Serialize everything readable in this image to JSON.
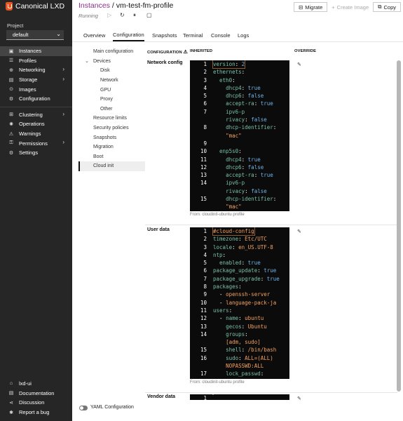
{
  "app": {
    "name": "Canonical LXD"
  },
  "project": {
    "label": "Project",
    "value": "default"
  },
  "sidebar": {
    "items": [
      {
        "label": "Instances",
        "icon": "instances-icon",
        "glyph": "▣",
        "active": true
      },
      {
        "label": "Profiles",
        "icon": "profiles-icon",
        "glyph": "☰"
      },
      {
        "label": "Networking",
        "icon": "networking-icon",
        "glyph": "⊕",
        "arrow": true
      },
      {
        "label": "Storage",
        "icon": "storage-icon",
        "glyph": "▤",
        "arrow": true
      },
      {
        "label": "Images",
        "icon": "images-icon",
        "glyph": "⊙"
      },
      {
        "label": "Configuration",
        "icon": "configuration-icon",
        "glyph": "⚙"
      }
    ],
    "items2": [
      {
        "label": "Clustering",
        "icon": "clustering-icon",
        "glyph": "⊞",
        "arrow": true
      },
      {
        "label": "Operations",
        "icon": "operations-icon",
        "glyph": "✺"
      },
      {
        "label": "Warnings",
        "icon": "warnings-icon",
        "glyph": "⚠"
      },
      {
        "label": "Permissions",
        "icon": "permissions-icon",
        "glyph": "⚿",
        "arrow": true
      },
      {
        "label": "Settings",
        "icon": "settings-icon",
        "glyph": "⚙"
      }
    ],
    "footer": [
      {
        "label": "lxd-ui",
        "icon": "code-icon",
        "glyph": "⌂"
      },
      {
        "label": "Documentation",
        "icon": "documentation-icon",
        "glyph": "▤"
      },
      {
        "label": "Discussion",
        "icon": "discussion-icon",
        "glyph": "⋖"
      },
      {
        "label": "Report a bug",
        "icon": "bug-icon",
        "glyph": "✱"
      }
    ]
  },
  "header": {
    "breadcrumb_link": "Instances",
    "breadcrumb_sep": " / ",
    "instance_name": "vm-test-fm-profile",
    "status": "Running",
    "migrate_label": "Migrate",
    "create_image_label": "Create Image",
    "copy_label": "Copy"
  },
  "tabs": [
    "Overview",
    "Configuration",
    "Snapshots",
    "Terminal",
    "Console",
    "Logs"
  ],
  "subnav": [
    {
      "label": "Main configuration"
    },
    {
      "label": "Devices",
      "arrow": true
    },
    {
      "label": "Disk",
      "indent": true
    },
    {
      "label": "Network",
      "indent": true
    },
    {
      "label": "GPU",
      "indent": true
    },
    {
      "label": "Proxy",
      "indent": true
    },
    {
      "label": "Other",
      "indent": true
    },
    {
      "label": "Resource limits"
    },
    {
      "label": "Security policies"
    },
    {
      "label": "Snapshots"
    },
    {
      "label": "Migration"
    },
    {
      "label": "Boot"
    },
    {
      "label": "Cloud init",
      "active": true
    }
  ],
  "table": {
    "col_configuration": "CONFIGURATION",
    "col_inherited": "INHERITED",
    "col_override": "OVERRIDE"
  },
  "rows": [
    {
      "label": "Network config",
      "from": "From: cloudinit-ubuntu profile",
      "lines": [
        {
          "n": "1",
          "t": [
            [
              "k",
              "version"
            ],
            [
              "w",
              ": "
            ],
            [
              "b",
              "2"
            ]
          ]
        },
        {
          "n": "2",
          "t": [
            [
              "k",
              "ethernets"
            ],
            [
              "w",
              ":"
            ]
          ]
        },
        {
          "n": "3",
          "t": [
            [
              "w",
              "  "
            ],
            [
              "k",
              "eth0"
            ],
            [
              "w",
              ":"
            ]
          ]
        },
        {
          "n": "4",
          "t": [
            [
              "w",
              "    "
            ],
            [
              "k",
              "dhcp4"
            ],
            [
              "w",
              ": "
            ],
            [
              "b",
              "true"
            ]
          ]
        },
        {
          "n": "5",
          "t": [
            [
              "w",
              "    "
            ],
            [
              "k",
              "dhcp6"
            ],
            [
              "w",
              ": "
            ],
            [
              "b",
              "false"
            ]
          ]
        },
        {
          "n": "6",
          "t": [
            [
              "w",
              "    "
            ],
            [
              "k",
              "accept-ra"
            ],
            [
              "w",
              ": "
            ],
            [
              "b",
              "true"
            ]
          ]
        },
        {
          "n": "7",
          "t": [
            [
              "w",
              "    "
            ],
            [
              "k",
              "ipv6-p"
            ]
          ]
        },
        {
          "n": "",
          "t": [
            [
              "w",
              "    "
            ],
            [
              "k",
              "rivacy"
            ],
            [
              "w",
              ": "
            ],
            [
              "b",
              "false"
            ]
          ]
        },
        {
          "n": "8",
          "t": [
            [
              "w",
              "    "
            ],
            [
              "k",
              "dhcp-identifier"
            ],
            [
              "w",
              ":"
            ]
          ]
        },
        {
          "n": "",
          "t": [
            [
              "w",
              "    "
            ],
            [
              "v",
              "\"mac\""
            ]
          ]
        },
        {
          "n": "9",
          "t": []
        },
        {
          "n": "10",
          "t": [
            [
              "w",
              "  "
            ],
            [
              "k",
              "enp5s0"
            ],
            [
              "w",
              ":"
            ]
          ]
        },
        {
          "n": "11",
          "t": [
            [
              "w",
              "    "
            ],
            [
              "k",
              "dhcp4"
            ],
            [
              "w",
              ": "
            ],
            [
              "b",
              "true"
            ]
          ]
        },
        {
          "n": "12",
          "t": [
            [
              "w",
              "    "
            ],
            [
              "k",
              "dhcp6"
            ],
            [
              "w",
              ": "
            ],
            [
              "b",
              "false"
            ]
          ]
        },
        {
          "n": "13",
          "t": [
            [
              "w",
              "    "
            ],
            [
              "k",
              "accept-ra"
            ],
            [
              "w",
              ": "
            ],
            [
              "b",
              "true"
            ]
          ]
        },
        {
          "n": "14",
          "t": [
            [
              "w",
              "    "
            ],
            [
              "k",
              "ipv6-p"
            ]
          ]
        },
        {
          "n": "",
          "t": [
            [
              "w",
              "    "
            ],
            [
              "k",
              "rivacy"
            ],
            [
              "w",
              ": "
            ],
            [
              "b",
              "false"
            ]
          ]
        },
        {
          "n": "15",
          "t": [
            [
              "w",
              "    "
            ],
            [
              "k",
              "dhcp-identifier"
            ],
            [
              "w",
              ":"
            ]
          ]
        },
        {
          "n": "",
          "t": [
            [
              "w",
              "    "
            ],
            [
              "v",
              "\"mac\""
            ]
          ]
        }
      ]
    },
    {
      "label": "User data",
      "from": "From: cloudinit-ubuntu profile",
      "lines": [
        {
          "n": "1",
          "t": [
            [
              "v",
              "#cloud-config"
            ]
          ]
        },
        {
          "n": "2",
          "t": [
            [
              "k",
              "timezone"
            ],
            [
              "w",
              ": "
            ],
            [
              "v",
              "Etc/UTC"
            ]
          ]
        },
        {
          "n": "3",
          "t": [
            [
              "k",
              "locale"
            ],
            [
              "w",
              ": "
            ],
            [
              "v",
              "en_US.UTF-8"
            ]
          ]
        },
        {
          "n": "4",
          "t": [
            [
              "k",
              "ntp"
            ],
            [
              "w",
              ":"
            ]
          ]
        },
        {
          "n": "5",
          "t": [
            [
              "w",
              "  "
            ],
            [
              "k",
              "enabled"
            ],
            [
              "w",
              ": "
            ],
            [
              "b",
              "true"
            ]
          ]
        },
        {
          "n": "6",
          "t": [
            [
              "k",
              "package_update"
            ],
            [
              "w",
              ": "
            ],
            [
              "b",
              "true"
            ]
          ]
        },
        {
          "n": "7",
          "t": [
            [
              "k",
              "package_upgrade"
            ],
            [
              "w",
              ": "
            ],
            [
              "b",
              "true"
            ]
          ]
        },
        {
          "n": "8",
          "t": [
            [
              "k",
              "packages"
            ],
            [
              "w",
              ":"
            ]
          ]
        },
        {
          "n": "9",
          "t": [
            [
              "w",
              "  - "
            ],
            [
              "v",
              "openssh-server"
            ]
          ]
        },
        {
          "n": "10",
          "t": [
            [
              "w",
              "  - "
            ],
            [
              "v",
              "language-pack-ja"
            ]
          ]
        },
        {
          "n": "11",
          "t": [
            [
              "k",
              "users"
            ],
            [
              "w",
              ":"
            ]
          ]
        },
        {
          "n": "12",
          "t": [
            [
              "w",
              "  - "
            ],
            [
              "k",
              "name"
            ],
            [
              "w",
              ": "
            ],
            [
              "v",
              "ubuntu"
            ]
          ]
        },
        {
          "n": "13",
          "t": [
            [
              "w",
              "    "
            ],
            [
              "k",
              "gecos"
            ],
            [
              "w",
              ": "
            ],
            [
              "v",
              "Ubuntu"
            ]
          ]
        },
        {
          "n": "14",
          "t": [
            [
              "w",
              "    "
            ],
            [
              "k",
              "groups"
            ],
            [
              "w",
              ":"
            ]
          ]
        },
        {
          "n": "",
          "t": [
            [
              "w",
              "    "
            ],
            [
              "v",
              "[adm, sudo]"
            ]
          ]
        },
        {
          "n": "15",
          "t": [
            [
              "w",
              "    "
            ],
            [
              "k",
              "shell"
            ],
            [
              "w",
              ": "
            ],
            [
              "v",
              "/bin/bash"
            ]
          ]
        },
        {
          "n": "16",
          "t": [
            [
              "w",
              "    "
            ],
            [
              "k",
              "sudo"
            ],
            [
              "w",
              ": "
            ],
            [
              "v",
              "ALL=(ALL)"
            ]
          ]
        },
        {
          "n": "",
          "t": [
            [
              "w",
              "    "
            ],
            [
              "v",
              "NOPASSWD:ALL"
            ]
          ]
        },
        {
          "n": "17",
          "t": [
            [
              "w",
              "    "
            ],
            [
              "k",
              "lock_passwd"
            ],
            [
              "w",
              ":"
            ]
          ]
        }
      ]
    },
    {
      "label": "Vendor data",
      "lines": [
        {
          "n": "1",
          "t": []
        }
      ]
    }
  ],
  "yaml_toggle_label": "YAML Configuration"
}
